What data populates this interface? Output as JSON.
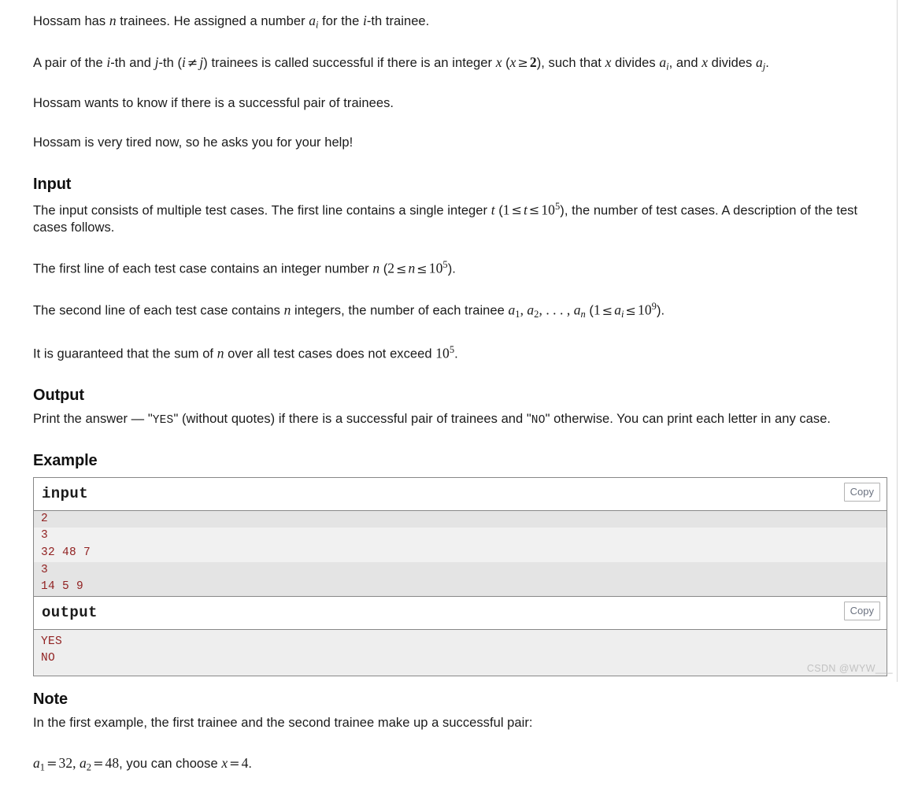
{
  "statement": {
    "p1": {
      "t1": "Hossam has ",
      "m1": "n",
      "t2": " trainees. He assigned a number ",
      "m2": "a",
      "m2s": "i",
      "t3": " for the ",
      "m3": "i",
      "t4": "-th trainee."
    },
    "p2": {
      "t1": "A pair of the ",
      "m1": "i",
      "t2": "-th and ",
      "m2": "j",
      "t3": "-th (",
      "m3": "i",
      "op1": "≠",
      "m4": "j",
      "t4": ") trainees is called successful if there is an integer ",
      "m5": "x",
      "t5": " (",
      "m6": "x",
      "op2": "≥",
      "m7": "2",
      "t6": "), such that ",
      "m8": "x",
      "t7": " divides ",
      "m9": "a",
      "m9s": "i",
      "t8": ", and ",
      "m10": "x",
      "t9": " divides ",
      "m11": "a",
      "m11s": "j",
      "t10": "."
    },
    "p3": "Hossam wants to know if there is a successful pair of trainees.",
    "p4": "Hossam is very tired now, so he asks you for your help!"
  },
  "input_section": {
    "title": "Input",
    "p1": {
      "t1": "The input consists of multiple test cases. The first line contains a single integer ",
      "m1": "t",
      "t2": " (",
      "m2": "1",
      "op1": "≤",
      "m3": "t",
      "op2": "≤",
      "m4": "10",
      "m4sup": "5",
      "t3": "), the number of test cases. A description of the test cases follows."
    },
    "p2": {
      "t1": "The first line of each test case contains an integer number ",
      "m1": "n",
      "t2": " (",
      "m2": "2",
      "op1": "≤",
      "m3": "n",
      "op2": "≤",
      "m4": "10",
      "m4sup": "5",
      "t3": ")."
    },
    "p3": {
      "t1": "The second line of each test case contains ",
      "m1": "n",
      "t2": " integers, the number of each trainee ",
      "m2": "a",
      "m2s": "1",
      "t3": ", ",
      "m3": "a",
      "m3s": "2",
      "t4": ", . . . , ",
      "m4": "a",
      "m4s": "n",
      "t5": " (",
      "m5": "1",
      "op1": "≤",
      "m6": "a",
      "m6s": "i",
      "op2": "≤",
      "m7": "10",
      "m7sup": "9",
      "t6": ")."
    },
    "p4": {
      "t1": "It is guaranteed that the sum of ",
      "m1": "n",
      "t2": " over all test cases does not exceed ",
      "m2": "10",
      "m2sup": "5",
      "t3": "."
    }
  },
  "output_section": {
    "title": "Output",
    "p1": {
      "t1": "Print the answer — \"",
      "code1": "YES",
      "t2": "\" (without quotes) if there is a successful pair of trainees and \"",
      "code2": "NO",
      "t3": "\" otherwise. You can print each letter in any case."
    }
  },
  "example_section": {
    "title": "Example",
    "input_label": "input",
    "output_label": "output",
    "copy_label": "Copy",
    "input_blocks": [
      {
        "lines": [
          "2"
        ]
      },
      {
        "lines": [
          "3",
          "32 48 7"
        ]
      },
      {
        "lines": [
          "3",
          "14 5 9"
        ]
      }
    ],
    "output_lines": [
      "YES",
      "NO"
    ]
  },
  "note_section": {
    "title": "Note",
    "p1": "In the first example, the first trainee and the second trainee make up a successful pair:",
    "p2": {
      "m1": "a",
      "m1s": "1",
      "op1": "=",
      "m2": "32",
      "t1": ", ",
      "m3": "a",
      "m3s": "2",
      "op2": "=",
      "m4": "48",
      "t2": ", you can choose ",
      "m5": "x",
      "op3": "=",
      "m6": "4",
      "t3": "."
    }
  },
  "watermark": "CSDN @WYW___",
  "colors": {
    "text": "#1b1b1b",
    "sample_text": "#912121",
    "border": "#888888",
    "copy_text": "#6b7280",
    "stripe_odd": "#e4e4e4",
    "stripe_even": "#f1f1f1"
  }
}
